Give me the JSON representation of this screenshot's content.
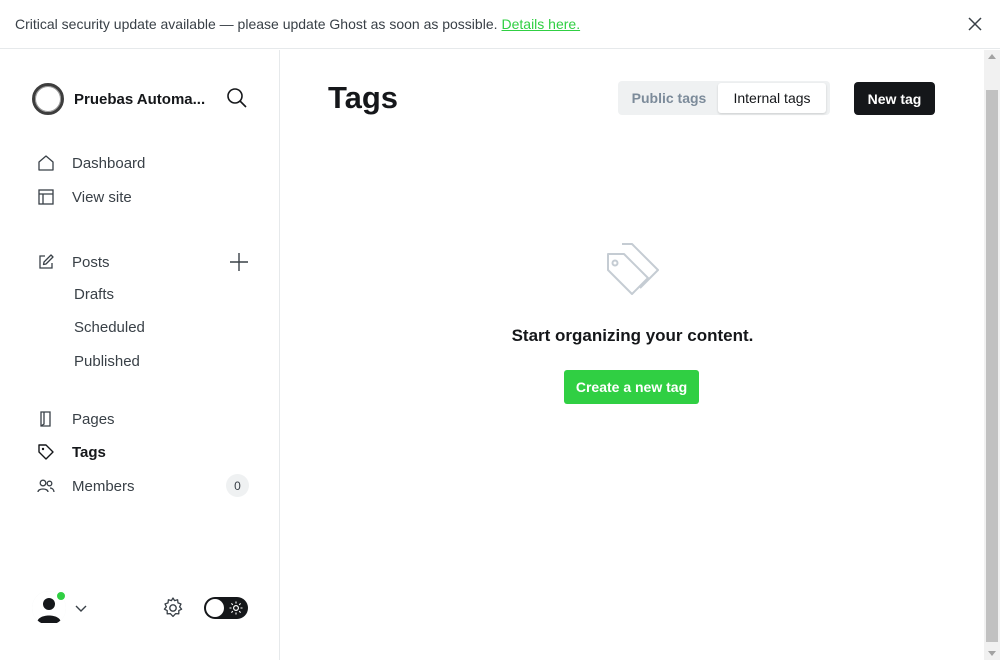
{
  "banner": {
    "message": "Critical security update available — please update Ghost as soon as possible.",
    "link_text": "Details here."
  },
  "sidebar": {
    "site_name": "Pruebas Automa...",
    "nav": {
      "dashboard": "Dashboard",
      "view_site": "View site",
      "posts": "Posts",
      "drafts": "Drafts",
      "scheduled": "Scheduled",
      "published": "Published",
      "pages": "Pages",
      "tags": "Tags",
      "members": "Members"
    },
    "members_count": "0"
  },
  "main": {
    "title": "Tags",
    "tabs": {
      "public": "Public tags",
      "internal": "Internal tags",
      "selected": "internal"
    },
    "new_tag_label": "New tag",
    "empty_state": {
      "message": "Start organizing your content.",
      "button_label": "Create a new tag"
    }
  },
  "colors": {
    "accent_green": "#30cf43",
    "primary_dark": "#15171a",
    "online_status": "#30cf43"
  }
}
